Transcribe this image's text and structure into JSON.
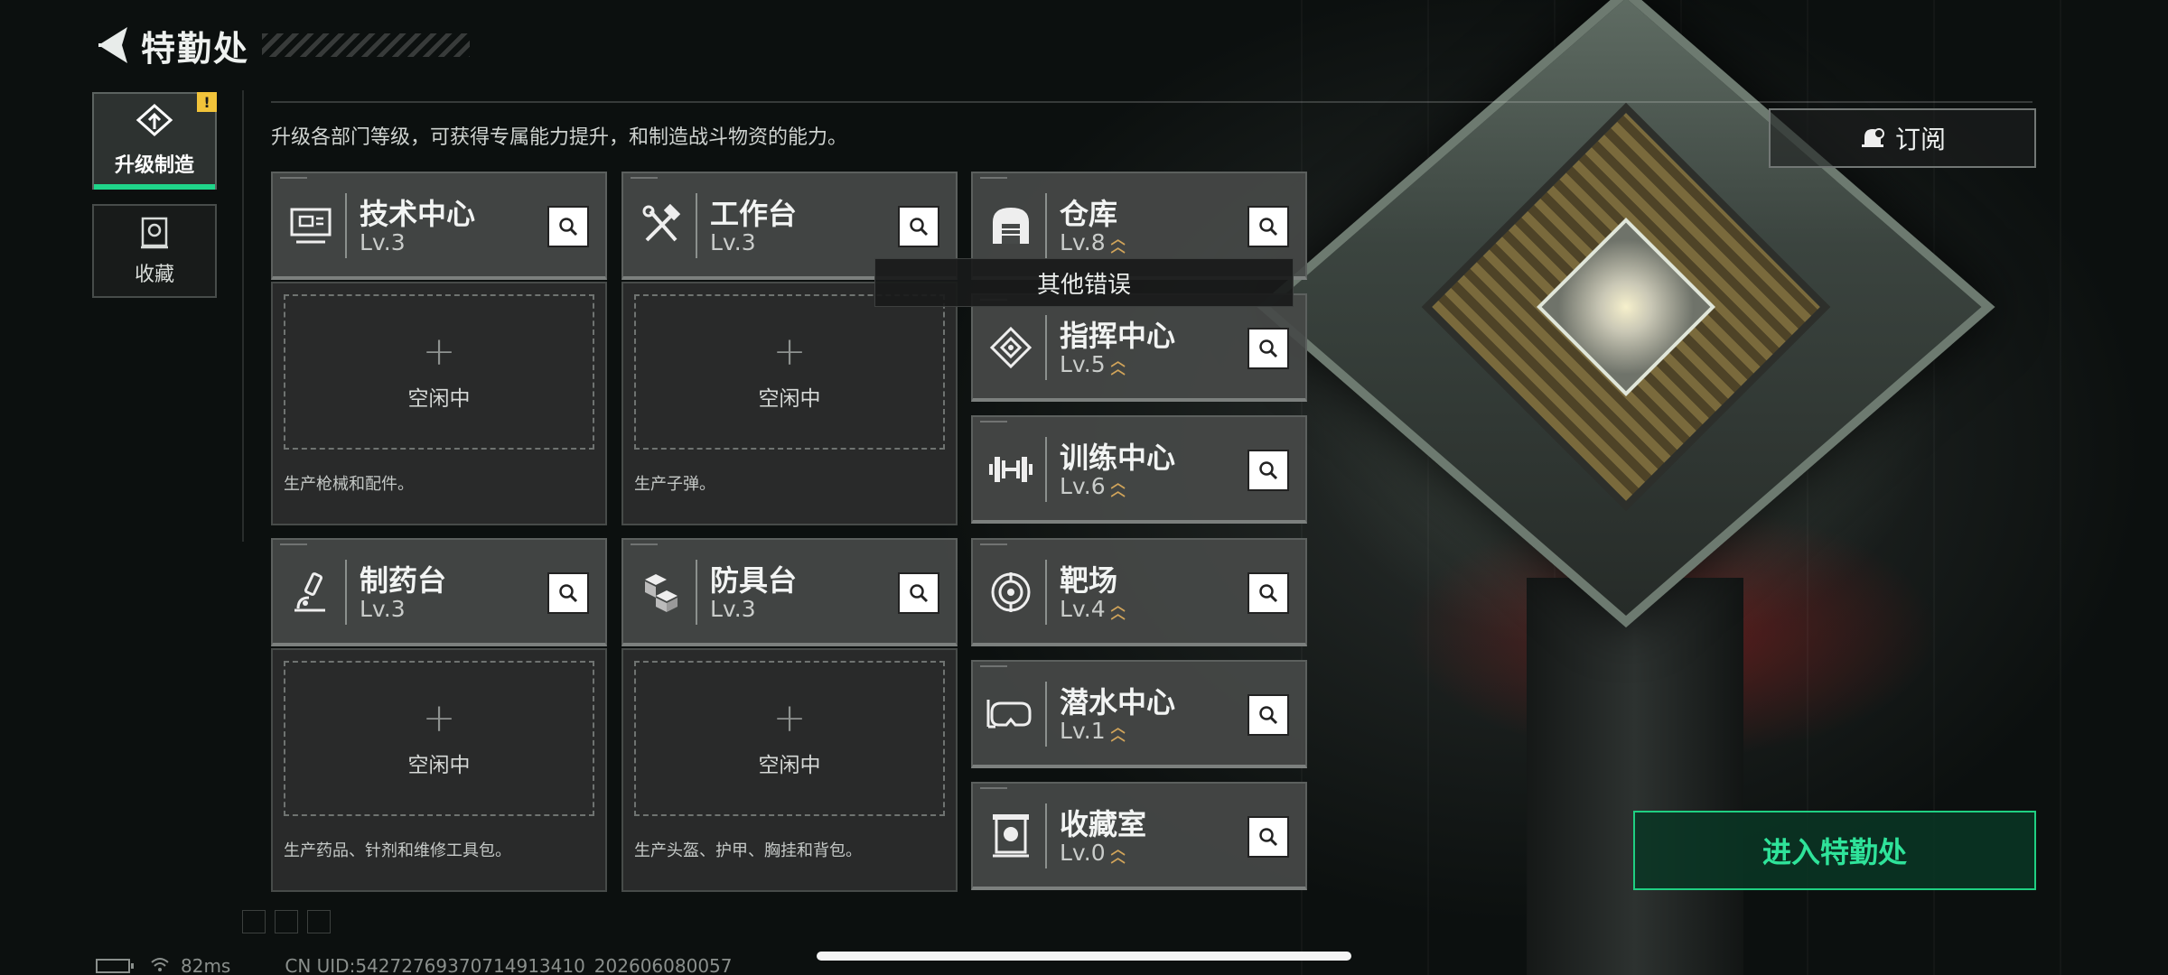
{
  "header": {
    "title": "特勤处"
  },
  "description": "升级各部门等级，可获得专属能力提升，和制造战斗物资的能力。",
  "side_tabs": [
    {
      "label": "升级制造",
      "icon": "upgrade-build-icon",
      "active": true,
      "badge": "!"
    },
    {
      "label": "收藏",
      "icon": "collection-icon",
      "active": false
    }
  ],
  "production_cards": [
    {
      "name": "技术中心",
      "level": "Lv.3",
      "icon": "tech-center-icon",
      "slot_status": "空闲中",
      "produce": "生产枪械和配件。"
    },
    {
      "name": "工作台",
      "level": "Lv.3",
      "icon": "workbench-icon",
      "slot_status": "空闲中",
      "produce": "生产子弹。"
    },
    {
      "name": "制药台",
      "level": "Lv.3",
      "icon": "pharmacy-icon",
      "slot_status": "空闲中",
      "produce": "生产药品、针剂和维修工具包。"
    },
    {
      "name": "防具台",
      "level": "Lv.3",
      "icon": "armor-bench-icon",
      "slot_status": "空闲中",
      "produce": "生产头盔、护甲、胸挂和背包。"
    }
  ],
  "facility_cards": [
    {
      "name": "仓库",
      "level": "Lv.8",
      "icon": "warehouse-icon",
      "upgradable": true
    },
    {
      "name": "指挥中心",
      "level": "Lv.5",
      "icon": "command-center-icon",
      "upgradable": true
    },
    {
      "name": "训练中心",
      "level": "Lv.6",
      "icon": "training-center-icon",
      "upgradable": true
    },
    {
      "name": "靶场",
      "level": "Lv.4",
      "icon": "shooting-range-icon",
      "upgradable": true
    },
    {
      "name": "潜水中心",
      "level": "Lv.1",
      "icon": "diving-center-icon",
      "upgradable": true
    },
    {
      "name": "收藏室",
      "level": "Lv.0",
      "icon": "collection-room-icon",
      "upgradable": true
    }
  ],
  "toast": "其他错误",
  "subscribe_label": "订阅",
  "enter_label": "进入特勤处",
  "status_bar": {
    "ping": "82ms",
    "uid": "CN UID:54272769370714913410_202606080057"
  },
  "colors": {
    "accent_green": "#1fd58a",
    "upgrade_arrow": "#d2a55a",
    "warn_badge": "#f1c33a"
  }
}
